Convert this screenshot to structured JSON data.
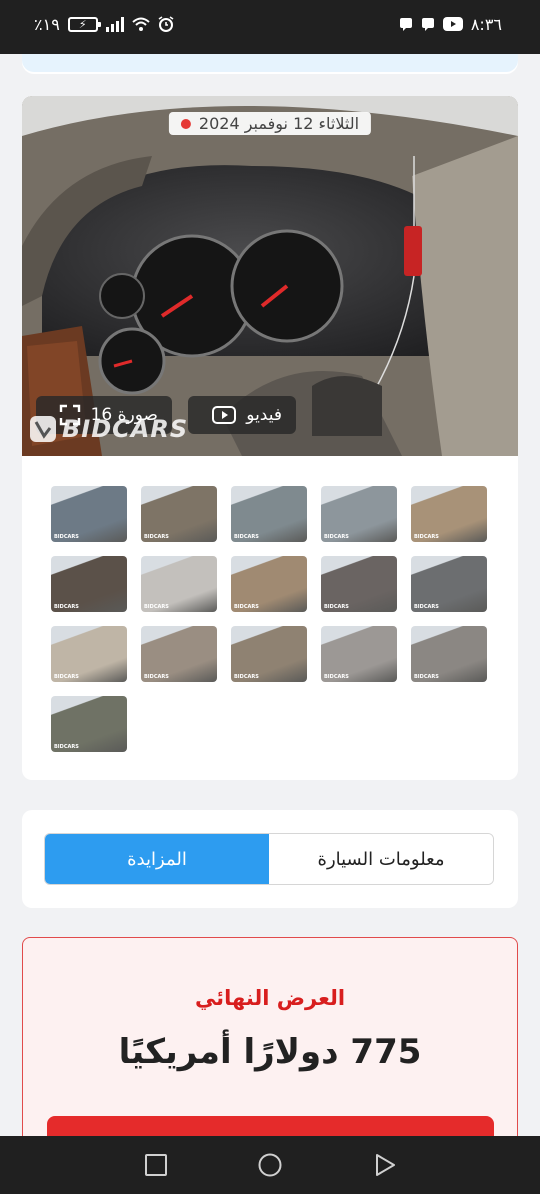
{
  "status_bar": {
    "time": "٨:٣٦",
    "battery": "٪١٩"
  },
  "gallery": {
    "date": "الثلاثاء 12 نوفمبر 2024",
    "video_label": "فيديو",
    "photos_label": "صورة 16",
    "watermark": "BIDCARS",
    "thumbnails": [
      {
        "alt": "exterior-front-left",
        "bg": "#6d7a86"
      },
      {
        "alt": "exterior-front",
        "bg": "#7e7466"
      },
      {
        "alt": "exterior-side",
        "bg": "#7f8a8f"
      },
      {
        "alt": "exterior-rear",
        "bg": "#8d969c"
      },
      {
        "alt": "interior-front-seats",
        "bg": "#a89278"
      },
      {
        "alt": "door-panel",
        "bg": "#5b5149"
      },
      {
        "alt": "headliner",
        "bg": "#c3c0bc"
      },
      {
        "alt": "rear-seats",
        "bg": "#a08a72"
      },
      {
        "alt": "window-sticker",
        "bg": "#6a6462"
      },
      {
        "alt": "engine-bay",
        "bg": "#6c6e70"
      },
      {
        "alt": "dashboard",
        "bg": "#bfb5a6"
      },
      {
        "alt": "seat-detail",
        "bg": "#9a8e82"
      },
      {
        "alt": "console",
        "bg": "#8f8272"
      },
      {
        "alt": "steering-wheel",
        "bg": "#9c9895"
      },
      {
        "alt": "armrest",
        "bg": "#8b8783"
      },
      {
        "alt": "wheel",
        "bg": "#6f7265"
      }
    ]
  },
  "tabs": {
    "auction": "المزايدة",
    "car_info": "معلومات السيارة"
  },
  "bid": {
    "label": "العرض النهائي",
    "amount": "775 دولارًا أمريكيًا"
  }
}
